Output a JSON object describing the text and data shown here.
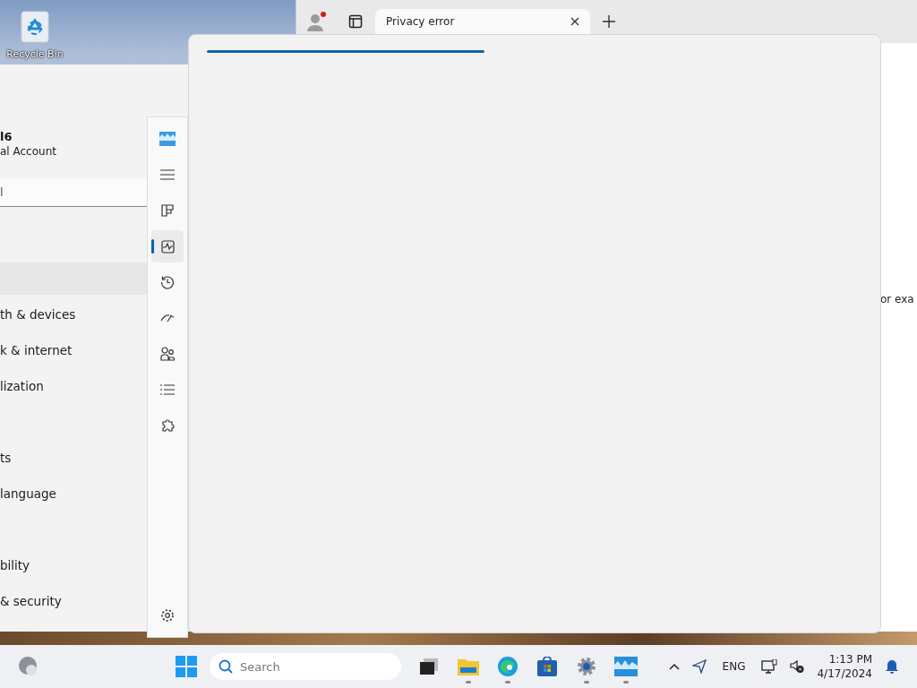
{
  "desktop": {
    "icons": [
      {
        "label": "Recycle Bin"
      }
    ]
  },
  "settings_window": {
    "account": {
      "name": "l6",
      "type": "al Account"
    },
    "search": {
      "value": "l"
    },
    "nav_items": [
      {
        "kind": "item",
        "selected": true
      },
      {
        "kind": "item",
        "label": "th & devices",
        "selected": false
      },
      {
        "kind": "item",
        "label": "k & internet",
        "selected": false
      },
      {
        "kind": "item",
        "label": "lization",
        "selected": false
      },
      {
        "kind": "gap"
      },
      {
        "kind": "item",
        "label": "ts",
        "selected": false
      },
      {
        "kind": "item",
        "label": "language",
        "selected": false
      },
      {
        "kind": "gap"
      },
      {
        "kind": "item",
        "label": "bility",
        "selected": false
      },
      {
        "kind": "item",
        "label": "& security",
        "selected": false
      }
    ]
  },
  "browser_window": {
    "tabs": [
      {
        "label": "Privacy error",
        "selected": true
      }
    ],
    "page_text": "or exa"
  },
  "dev_home_sidebar": {
    "items": [
      {
        "kind": "logo",
        "selected": false
      },
      {
        "kind": "menu",
        "selected": false
      },
      {
        "kind": "dashboard",
        "selected": false
      },
      {
        "kind": "activity",
        "selected": true
      },
      {
        "kind": "history",
        "selected": false
      },
      {
        "kind": "gauge",
        "selected": false
      },
      {
        "kind": "people",
        "selected": false
      },
      {
        "kind": "list",
        "selected": false
      },
      {
        "kind": "puzzle",
        "selected": false
      }
    ],
    "bottom_item": {
      "kind": "settings",
      "selected": false
    }
  },
  "taskbar": {
    "search": {
      "placeholder": "Search"
    },
    "apps": [
      {
        "kind": "taskview",
        "running": false
      },
      {
        "kind": "files",
        "running": true
      },
      {
        "kind": "edge",
        "running": true
      },
      {
        "kind": "store",
        "running": false
      },
      {
        "kind": "settings",
        "running": true
      },
      {
        "kind": "devhome",
        "running": true
      }
    ],
    "language": "ENG",
    "time": "1:13 PM",
    "date": "4/17/2024"
  }
}
